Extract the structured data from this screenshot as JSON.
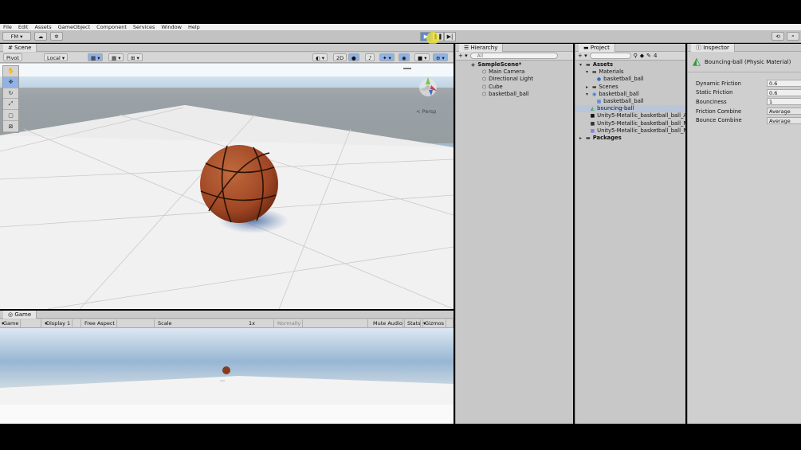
{
  "menubar": {
    "items": [
      "File",
      "Edit",
      "Assets",
      "GameObject",
      "Component",
      "Services",
      "Window",
      "Help"
    ]
  },
  "toolbar": {
    "account_label": "FM ▾",
    "play_icon": "play-icon",
    "pause_icon": "pause-icon",
    "step_icon": "step-icon"
  },
  "scene": {
    "tab_label": "Scene",
    "pivot_label": "Pivot",
    "local_label": "Local",
    "mode_2d": "2D",
    "persp_label": "< Persp",
    "tools": [
      "hand-tool-icon",
      "move-tool-icon",
      "rotate-tool-icon",
      "scale-tool-icon",
      "rect-tool-icon",
      "transform-tool-icon"
    ]
  },
  "game": {
    "tab_label": "Game",
    "view_dropdown": "Game",
    "display_dropdown": "Display 1",
    "aspect_dropdown": "Free Aspect",
    "scale_label": "Scale",
    "scale_value": "1x",
    "normally_dropdown": "Normally",
    "mute_audio": "Mute Audio",
    "stats": "Stats",
    "gizmos": "Gizmos"
  },
  "hierarchy": {
    "tab_label": "Hierarchy",
    "search_placeholder": "All",
    "scene_name": "SampleScene*",
    "items": [
      "Main Camera",
      "Directional Light",
      "Cube",
      "basketball_ball"
    ]
  },
  "project": {
    "tab_label": "Project",
    "badge_count": "4",
    "assets": "Assets",
    "materials": "Materials",
    "material_item": "basketball_ball",
    "scenes": "Scenes",
    "basketball_folder": "basketball_ball",
    "basketball_child": "basketball_ball",
    "bouncing_ball": "bouncing-ball",
    "textures": [
      "Unity5-Metallic_basketball_ball_Al",
      "Unity5-Metallic_basketball_ball_M",
      "Unity5-Metallic_basketball_ball_N"
    ],
    "packages": "Packages"
  },
  "inspector": {
    "tab_label": "Inspector",
    "title": "Bouncing-ball (Physic Material)",
    "rows": [
      {
        "label": "Dynamic Friction",
        "value": "0.6"
      },
      {
        "label": "Static Friction",
        "value": "0.6"
      },
      {
        "label": "Bounciness",
        "value": "1"
      },
      {
        "label": "Friction Combine",
        "value": "Average"
      },
      {
        "label": "Bounce Combine",
        "value": "Average"
      }
    ]
  },
  "colors": {
    "play_active": "#5b8bd6",
    "selection": "#b9c5d8",
    "ball": "#a4502c"
  }
}
